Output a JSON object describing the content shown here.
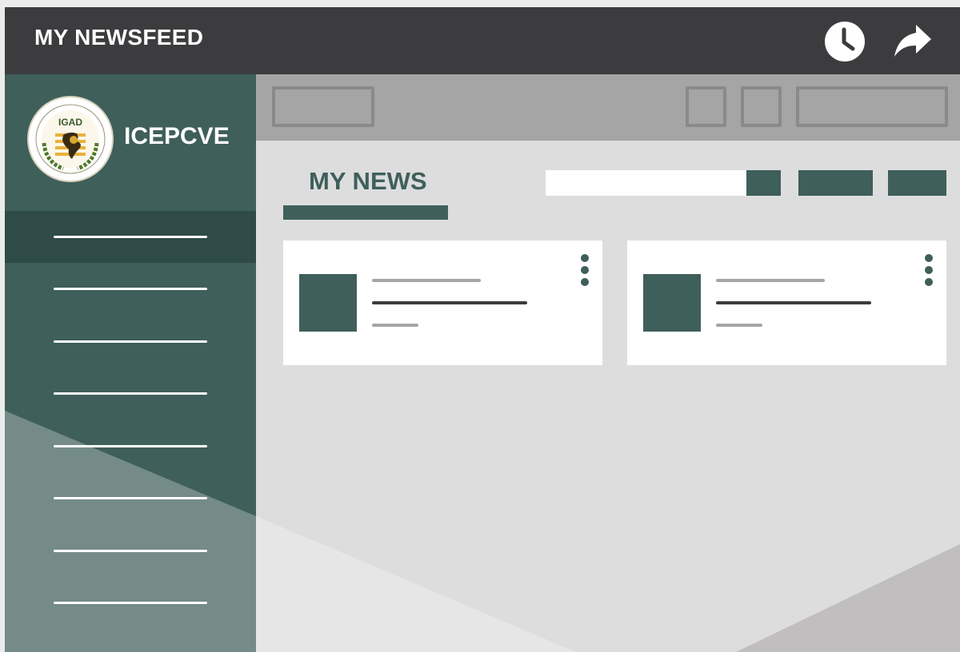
{
  "header": {
    "title": "MY NEWSFEED",
    "icons": [
      "clock-icon",
      "share-icon"
    ]
  },
  "sidebar": {
    "brand_name": "ICEPCVE",
    "logo": {
      "text": "IGAD",
      "ring_text": "INTERGOVERNMENTAL AUTHORITY ON DEVELOPMENT • AUTORITÉ INTERGOUVERNEMENTALE POUR LE DÉVELOPPEMENT"
    },
    "nav_item_count": 8,
    "active_index": 0
  },
  "main": {
    "section_title": "MY NEWS",
    "search": {
      "placeholder": "",
      "value": ""
    }
  },
  "colors": {
    "topbar": "#3c3c3e",
    "accent": "#3f5f5b",
    "accent_dark": "#2f4b47",
    "toolbar": "#a5a5a5",
    "content_bg": "#dddddd",
    "card": "#ffffff"
  }
}
